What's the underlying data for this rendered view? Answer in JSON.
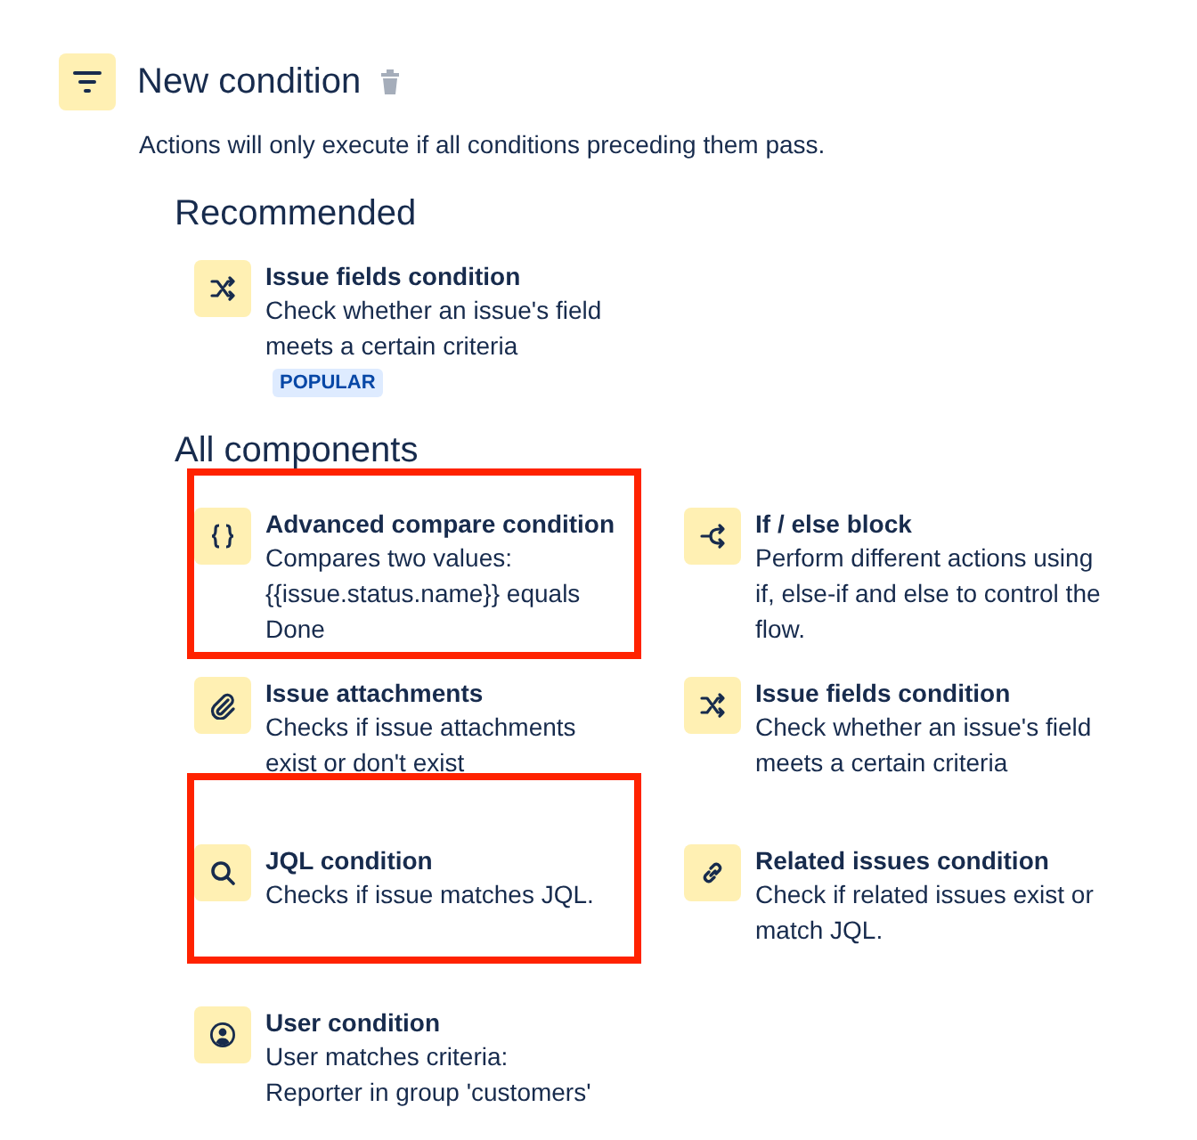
{
  "header": {
    "title": "New condition",
    "description": "Actions will only execute if all conditions preceding them pass."
  },
  "recommended": {
    "heading": "Recommended",
    "items": [
      {
        "kind": "shuffle",
        "title": "Issue fields condition",
        "description": "Check whether an issue's field meets a certain criteria",
        "badge": "POPULAR"
      }
    ]
  },
  "all_components": {
    "heading": "All components",
    "items": [
      {
        "kind": "braces",
        "title": "Advanced compare condition",
        "description": "Compares two values: {{issue.status.name}} equals Done",
        "highlighted": true
      },
      {
        "kind": "branch",
        "title": "If / else block",
        "description": "Perform different actions using if, else-if and else to control the flow.",
        "highlighted": false
      },
      {
        "kind": "paperclip",
        "title": "Issue attachments",
        "description": "Checks if issue attachments exist or don't exist",
        "highlighted": false
      },
      {
        "kind": "shuffle",
        "title": "Issue fields condition",
        "description": "Check whether an issue's field meets a certain criteria",
        "highlighted": false
      },
      {
        "kind": "search",
        "title": "JQL condition",
        "description": "Checks if issue matches JQL.",
        "highlighted": true
      },
      {
        "kind": "link",
        "title": "Related issues condition",
        "description": "Check if related issues exist or match JQL.",
        "highlighted": false
      },
      {
        "kind": "user",
        "title": "User condition",
        "description": "User matches criteria: Reporter in group 'customers'",
        "highlighted": false
      }
    ]
  }
}
